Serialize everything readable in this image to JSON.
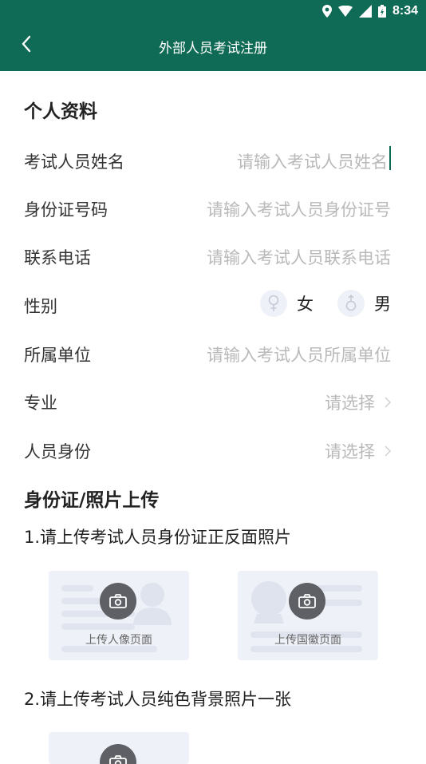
{
  "status": {
    "time": "8:34"
  },
  "appbar": {
    "title": "外部人员考试注册"
  },
  "personal": {
    "title": "个人资料",
    "name_label": "考试人员姓名",
    "name_placeholder": "请输入考试人员姓名",
    "id_label": "身份证号码",
    "id_placeholder": "请输入考试人员身份证号",
    "phone_label": "联系电话",
    "phone_placeholder": "请输入考试人员联系电话",
    "gender_label": "性别",
    "gender_female": "女",
    "gender_male": "男",
    "unit_label": "所属单位",
    "unit_placeholder": "请输入考试人员所属单位",
    "major_label": "专业",
    "major_value": "请选择",
    "identity_label": "人员身份",
    "identity_value": "请选择"
  },
  "upload": {
    "title": "身份证/照片上传",
    "step1": "1.请上传考试人员身份证正反面照片",
    "front_label": "上传人像页面",
    "back_label": "上传国徽页面",
    "step2": "2.请上传考试人员纯色背景照片一张"
  },
  "colors": {
    "primary": "#0f6b55",
    "placeholder": "#b9b9b9",
    "card_bg": "#eef1f8"
  }
}
